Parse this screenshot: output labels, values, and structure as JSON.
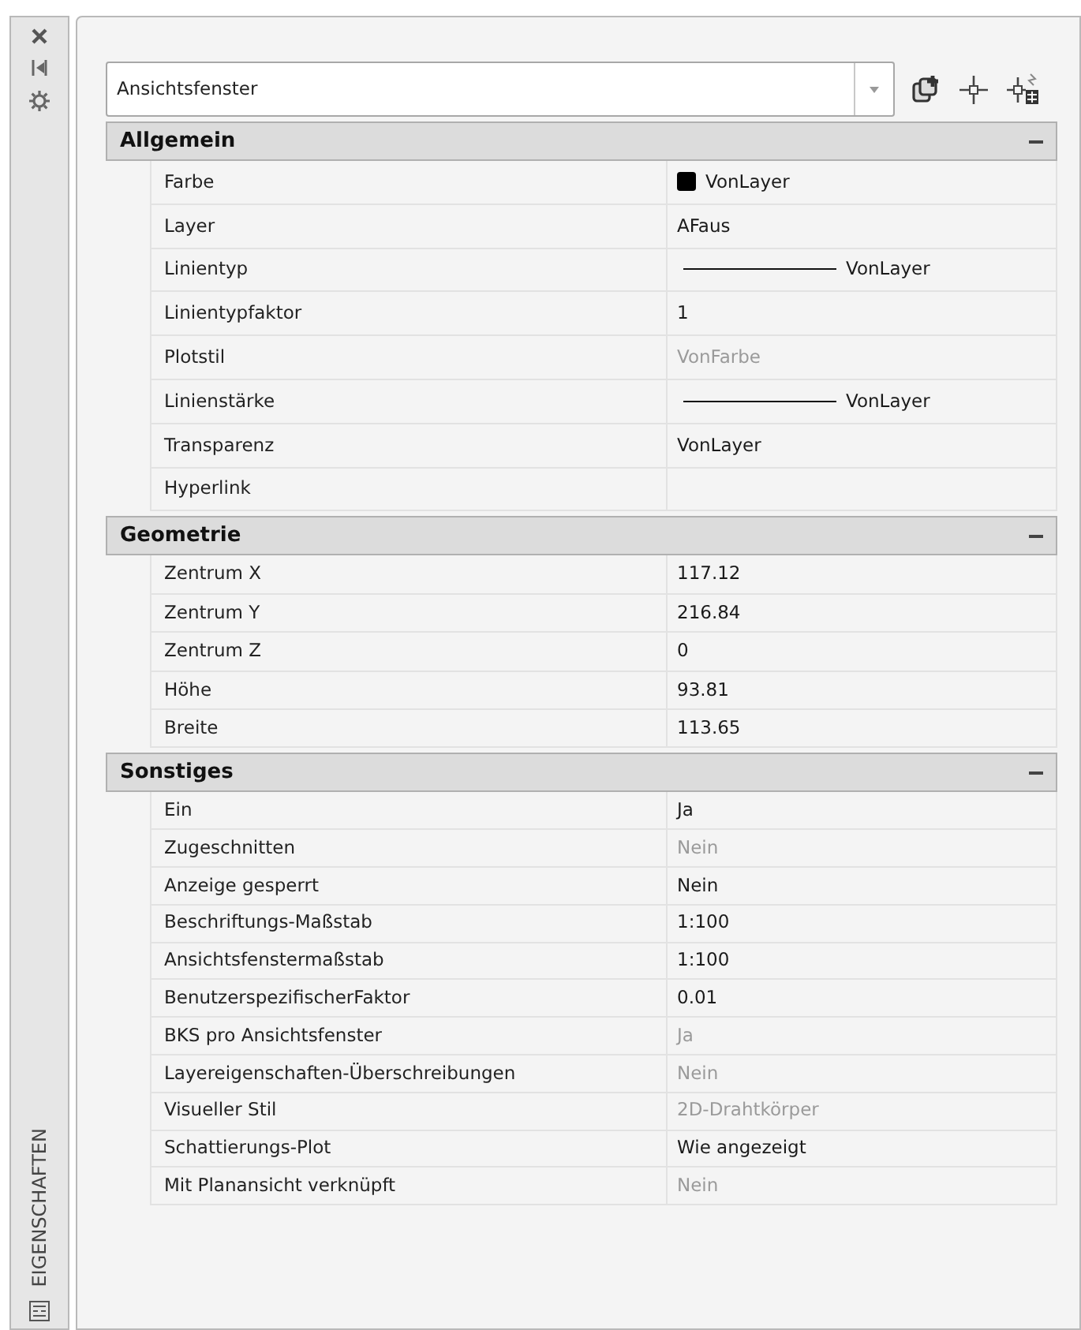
{
  "side_strip": {
    "title": "EIGENSCHAFTEN"
  },
  "selector": {
    "value": "Ansichtsfenster"
  },
  "sections": [
    {
      "title": "Allgemein",
      "expanded": true,
      "rows": [
        {
          "label": "Farbe",
          "kind": "color",
          "value": "VonLayer",
          "color": "#000000",
          "disabled": false
        },
        {
          "label": "Layer",
          "kind": "text",
          "value": "AFaus",
          "disabled": false
        },
        {
          "label": "Linientyp",
          "kind": "line",
          "value": "VonLayer",
          "disabled": false
        },
        {
          "label": "Linientypfaktor",
          "kind": "text",
          "value": "1",
          "disabled": false
        },
        {
          "label": "Plotstil",
          "kind": "text",
          "value": "VonFarbe",
          "disabled": true
        },
        {
          "label": "Linienstärke",
          "kind": "line",
          "value": "VonLayer",
          "disabled": false
        },
        {
          "label": "Transparenz",
          "kind": "text",
          "value": "VonLayer",
          "disabled": false
        },
        {
          "label": "Hyperlink",
          "kind": "empty"
        }
      ]
    },
    {
      "title": "Geometrie",
      "expanded": true,
      "rows": [
        {
          "label": "Zentrum X",
          "kind": "text",
          "value": "117.12",
          "disabled": false
        },
        {
          "label": "Zentrum Y",
          "kind": "text",
          "value": "216.84",
          "disabled": false
        },
        {
          "label": "Zentrum Z",
          "kind": "text",
          "value": "0",
          "disabled": false
        },
        {
          "label": "Höhe",
          "kind": "text",
          "value": "93.81",
          "disabled": false
        },
        {
          "label": "Breite",
          "kind": "text",
          "value": "113.65",
          "disabled": false
        }
      ]
    },
    {
      "title": "Sonstiges",
      "expanded": true,
      "rows": [
        {
          "label": "Ein",
          "kind": "text",
          "value": "Ja",
          "disabled": false
        },
        {
          "label": "Zugeschnitten",
          "kind": "text",
          "value": "Nein",
          "disabled": true
        },
        {
          "label": "Anzeige gesperrt",
          "kind": "text",
          "value": "Nein",
          "disabled": false
        },
        {
          "label": "Beschriftungs-Maßstab",
          "kind": "text",
          "value": "1:100",
          "disabled": false
        },
        {
          "label": "Ansichtsfenstermaßstab",
          "kind": "text",
          "value": "1:100",
          "disabled": false
        },
        {
          "label": "BenutzerspezifischerFaktor",
          "kind": "text",
          "value": "0.01",
          "disabled": false
        },
        {
          "label": "BKS pro Ansichtsfenster",
          "kind": "text",
          "value": "Ja",
          "disabled": true
        },
        {
          "label": "Layereigenschaften-Überschreibungen",
          "kind": "text",
          "value": "Nein",
          "disabled": true
        },
        {
          "label": "Visueller Stil",
          "kind": "text",
          "value": "2D-Drahtkörper",
          "disabled": true
        },
        {
          "label": "Schattierungs-Plot",
          "kind": "text",
          "value": "Wie angezeigt",
          "disabled": false
        },
        {
          "label": "Mit Planansicht verknüpft",
          "kind": "text",
          "value": "Nein",
          "disabled": true
        }
      ]
    }
  ]
}
